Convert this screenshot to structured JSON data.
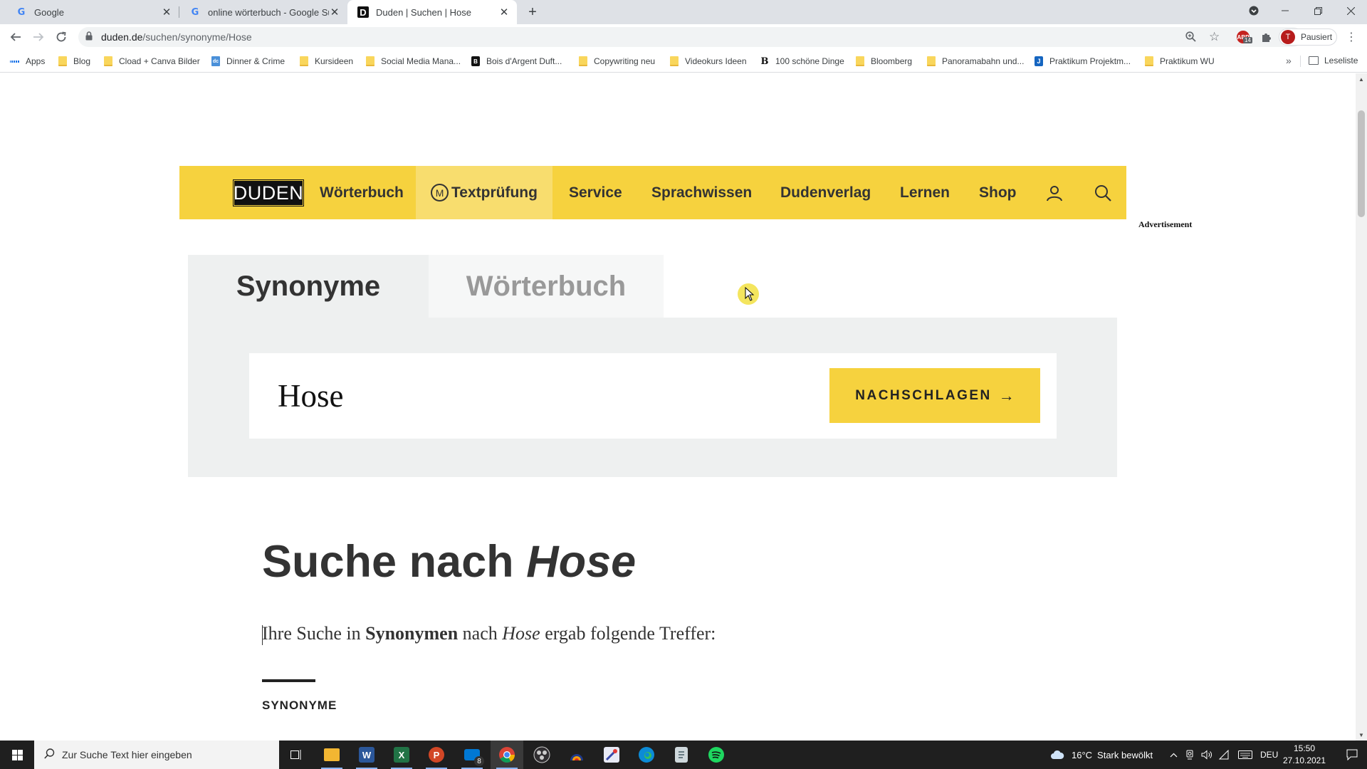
{
  "browser": {
    "tabs": [
      {
        "title": "Google",
        "favicon": "google-icon"
      },
      {
        "title": "online wörterbuch - Google Such",
        "favicon": "google-icon"
      },
      {
        "title": "Duden | Suchen | Hose",
        "favicon": "duden-icon"
      }
    ],
    "url_host": "duden.de",
    "url_path": "/suchen/synonyme/Hose",
    "profile_initial": "T",
    "profile_label": "Pausiert",
    "extension_badge": "14"
  },
  "bookmarks": {
    "apps_label": "Apps",
    "items": [
      {
        "label": "Blog",
        "icon": "folder-icon"
      },
      {
        "label": "Cload + Canva Bilder",
        "icon": "folder-icon"
      },
      {
        "label": "Dinner & Crime",
        "icon": "site-icon",
        "badge": "dc"
      },
      {
        "label": "Kursideen",
        "icon": "folder-icon"
      },
      {
        "label": "Social Media Mana...",
        "icon": "folder-icon"
      },
      {
        "label": "Bois d'Argent Duft...",
        "icon": "site-icon",
        "badge": "B"
      },
      {
        "label": "Copywriting neu",
        "icon": "folder-icon"
      },
      {
        "label": "Videokurs Ideen",
        "icon": "folder-icon"
      },
      {
        "label": "100 schöne Dinge",
        "icon": "site-icon",
        "badge": "B"
      },
      {
        "label": "Bloomberg",
        "icon": "folder-icon"
      },
      {
        "label": "Panoramabahn und...",
        "icon": "folder-icon"
      },
      {
        "label": "Praktikum Projektm...",
        "icon": "site-icon",
        "badge": "J"
      },
      {
        "label": "Praktikum WU",
        "icon": "folder-icon"
      }
    ],
    "more_label": "»",
    "reading_list_label": "Leseliste"
  },
  "duden": {
    "logo_text": "DUDEN",
    "nav": [
      {
        "label": "Wörterbuch"
      },
      {
        "label": "Textprüfung",
        "badge": "M"
      },
      {
        "label": "Service"
      },
      {
        "label": "Sprachwissen"
      },
      {
        "label": "Dudenverlag"
      },
      {
        "label": "Lernen"
      },
      {
        "label": "Shop"
      }
    ],
    "advertisement_label": "Advertisement",
    "search_tabs": [
      {
        "label": "Synonyme",
        "selected": true
      },
      {
        "label": "Wörterbuch",
        "selected": false
      }
    ],
    "search_value": "Hose",
    "search_button": "NACHSCHLAGEN",
    "search_button_arrow": "→",
    "result_title_prefix": "Suche nach",
    "result_title_term": "Hose",
    "result_line": {
      "part1": "Ihre Suche in",
      "bold": "Synonymen",
      "part2": "nach",
      "italic": "Hose",
      "part3": "ergab folgende Treffer:"
    },
    "section_heading": "SYNONYME",
    "colors": {
      "brand_yellow": "#f6d23e",
      "panel_gray": "#eef0f0",
      "text_dark": "#333333"
    }
  },
  "taskbar": {
    "search_placeholder": "Zur Suche Text hier eingeben",
    "mail_badge": "8",
    "weather_temp": "16°C",
    "weather_text": "Stark bewölkt",
    "language": "DEU",
    "time": "15:50",
    "date": "27.10.2021"
  }
}
